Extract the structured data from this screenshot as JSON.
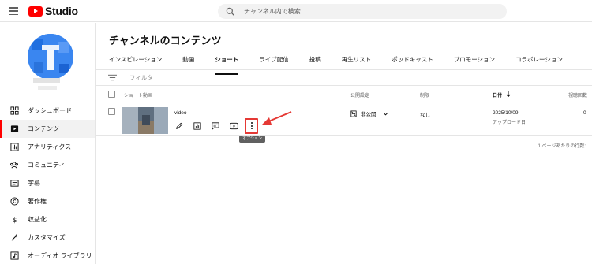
{
  "app": {
    "logo_text": "Studio",
    "brand_color": "#ff0000"
  },
  "search": {
    "placeholder": "チャンネル内で検索"
  },
  "sidebar": {
    "items": [
      {
        "label": "ダッシュボード",
        "icon": "dashboard-icon",
        "active": false
      },
      {
        "label": "コンテンツ",
        "icon": "content-icon",
        "active": true
      },
      {
        "label": "アナリティクス",
        "icon": "analytics-icon",
        "active": false
      },
      {
        "label": "コミュニティ",
        "icon": "community-icon",
        "active": false
      },
      {
        "label": "字幕",
        "icon": "subtitles-icon",
        "active": false
      },
      {
        "label": "著作権",
        "icon": "copyright-icon",
        "active": false
      },
      {
        "label": "収益化",
        "icon": "monetization-icon",
        "active": false
      },
      {
        "label": "カスタマイズ",
        "icon": "customize-icon",
        "active": false
      },
      {
        "label": "オーディオ ライブラリ",
        "icon": "audio-library-icon",
        "active": false
      }
    ]
  },
  "main": {
    "title": "チャンネルのコンテンツ",
    "tabs": [
      {
        "label": "インスピレーション",
        "active": false
      },
      {
        "label": "動画",
        "active": false
      },
      {
        "label": "ショート",
        "active": true
      },
      {
        "label": "ライブ配信",
        "active": false
      },
      {
        "label": "投稿",
        "active": false
      },
      {
        "label": "再生リスト",
        "active": false
      },
      {
        "label": "ポッドキャスト",
        "active": false
      },
      {
        "label": "プロモーション",
        "active": false
      },
      {
        "label": "コラボレーション",
        "active": false
      }
    ],
    "filter_label": "フィルタ",
    "columns": {
      "video": "ショート動画",
      "visibility": "公開設定",
      "restrictions": "制限",
      "date": "日付",
      "views": "視聴回数"
    },
    "row": {
      "title": "video",
      "visibility": "非公開",
      "restrictions": "なし",
      "date": "2025/10/09",
      "date_sub": "アップロード日",
      "views": "0",
      "options_tooltip": "オプション"
    },
    "pager_text": "1 ページあたりの行数:",
    "annotation_color": "#e53935"
  }
}
